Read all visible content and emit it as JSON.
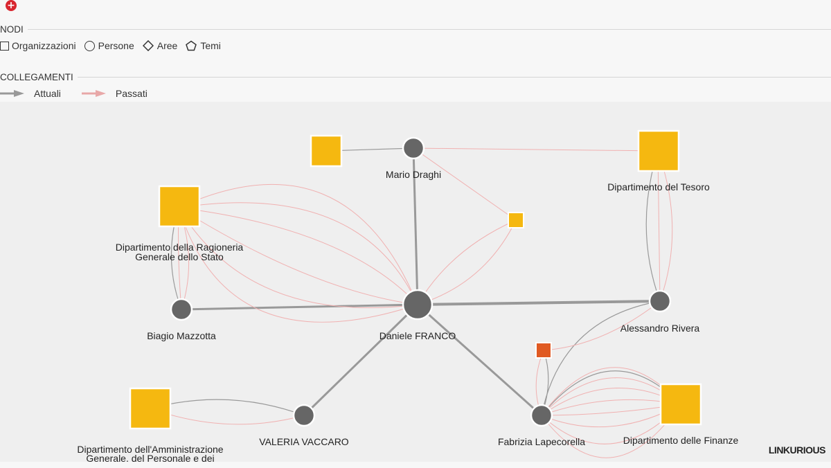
{
  "toolbar": {
    "add_button_icon": "plus-circle-icon",
    "add_glyph": "+"
  },
  "legend": {
    "nodes_title": "NODI",
    "node_types": [
      {
        "shape": "square",
        "label": "Organizzazioni"
      },
      {
        "shape": "circle",
        "label": "Persone"
      },
      {
        "shape": "diamond",
        "label": "Aree"
      },
      {
        "shape": "pentagon",
        "label": "Temi"
      }
    ],
    "links_title": "COLLEGAMENTI",
    "link_types": [
      {
        "label": "Attuali",
        "color": "#999999"
      },
      {
        "label": "Passati",
        "color": "#e8a8a8"
      }
    ]
  },
  "colors": {
    "organization": "#f5b810",
    "organization_alt": "#e05a22",
    "person": "#666666",
    "current_link": "#999999",
    "past_link": "#f0b0b0"
  },
  "graph": {
    "nodes": [
      {
        "id": "daniele",
        "type": "person",
        "label": "Daniele FRANCO"
      },
      {
        "id": "draghi",
        "type": "person",
        "label": "Mario Draghi"
      },
      {
        "id": "mazzotta",
        "type": "person",
        "label": "Biagio Mazzotta"
      },
      {
        "id": "rivera",
        "type": "person",
        "label": "Alessandro Rivera"
      },
      {
        "id": "vaccaro",
        "type": "person",
        "label": "VALERIA VACCARO"
      },
      {
        "id": "lapecorella",
        "type": "person",
        "label": "Fabrizia Lapecorella"
      },
      {
        "id": "rgs",
        "type": "organization",
        "label_lines": [
          "Dipartimento della Ragioneria",
          "Generale dello Stato"
        ]
      },
      {
        "id": "tesoro",
        "type": "organization",
        "label_lines": [
          "Dipartimento del Tesoro"
        ]
      },
      {
        "id": "finanze",
        "type": "organization",
        "label_lines": [
          "Dipartimento delle Finanze"
        ]
      },
      {
        "id": "dag",
        "type": "organization",
        "label_lines": [
          "Dipartimento dell'Amministrazione",
          "Generale, del Personale e dei"
        ]
      },
      {
        "id": "org_small_top",
        "type": "organization",
        "label_lines": []
      },
      {
        "id": "org_small_mid",
        "type": "organization",
        "label_lines": []
      },
      {
        "id": "org_orange",
        "type": "organization_alt",
        "label_lines": []
      }
    ]
  },
  "brand": {
    "name": "LINKURIOUS"
  }
}
